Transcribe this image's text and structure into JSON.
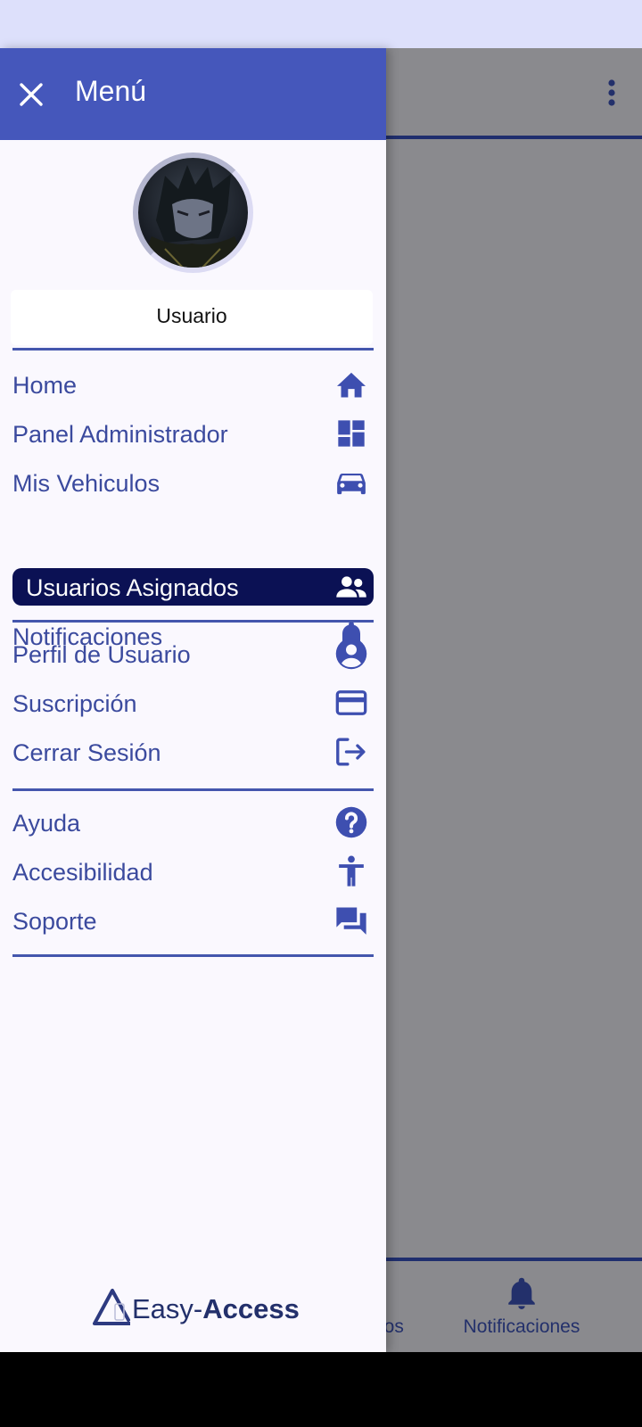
{
  "drawer": {
    "title": "Menú",
    "username": "Usuario",
    "groups": [
      [
        {
          "label": "Home",
          "icon": "home-icon"
        },
        {
          "label": "Panel Administrador",
          "icon": "dashboard-icon"
        },
        {
          "label": "Mis Vehiculos",
          "icon": "car-icon"
        },
        {
          "label": "Usuarios Asignados",
          "icon": "people-icon",
          "active": true
        },
        {
          "label": "Notificaciones",
          "icon": "bell-icon"
        }
      ],
      [
        {
          "label": "Perfil de Usuario",
          "icon": "account-circle-icon"
        },
        {
          "label": "Suscripción",
          "icon": "credit-card-icon"
        },
        {
          "label": "Cerrar Sesión",
          "icon": "logout-icon"
        }
      ],
      [
        {
          "label": "Ayuda",
          "icon": "help-icon"
        },
        {
          "label": "Accesibilidad",
          "icon": "accessibility-icon"
        },
        {
          "label": "Soporte",
          "icon": "forum-icon"
        }
      ]
    ],
    "logo": {
      "part1": "Easy-",
      "part2": "Access"
    }
  },
  "background": {
    "bottom_nav": {
      "partial_label": "los",
      "notifications_label": "Notificaciones"
    }
  },
  "colors": {
    "accent": "#4557bb",
    "active_bg": "#0b1154",
    "menu_text": "#3b4a9e",
    "status_bar": "#dde0fb"
  }
}
